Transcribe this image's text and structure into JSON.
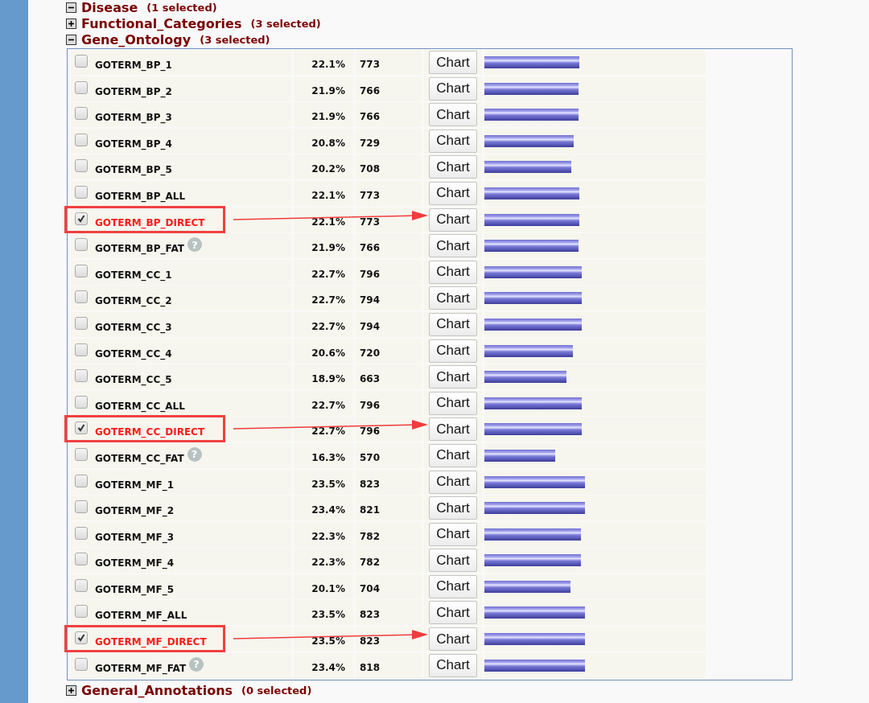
{
  "sections_top": [
    {
      "title": "Disease",
      "count": "(1 selected)",
      "expanded": true
    },
    {
      "title": "Functional_Categories",
      "count": "(3 selected)",
      "expanded": false
    },
    {
      "title": "Gene_Ontology",
      "count": "(3 selected)",
      "expanded": true
    }
  ],
  "rows": [
    {
      "name": "GOTERM_BP_1",
      "checked": false,
      "annotated": false,
      "percent": "22.1%",
      "count": "773",
      "button": "Chart",
      "level": 0.43
    },
    {
      "name": "GOTERM_BP_2",
      "checked": false,
      "annotated": false,
      "percent": "21.9%",
      "count": "766",
      "button": "Chart",
      "level": 0.425
    },
    {
      "name": "GOTERM_BP_3",
      "checked": false,
      "annotated": false,
      "percent": "21.9%",
      "count": "766",
      "button": "Chart",
      "level": 0.425
    },
    {
      "name": "GOTERM_BP_4",
      "checked": false,
      "annotated": false,
      "percent": "20.8%",
      "count": "729",
      "button": "Chart",
      "level": 0.405
    },
    {
      "name": "GOTERM_BP_5",
      "checked": false,
      "annotated": false,
      "percent": "20.2%",
      "count": "708",
      "button": "Chart",
      "level": 0.393
    },
    {
      "name": "GOTERM_BP_ALL",
      "checked": false,
      "annotated": false,
      "percent": "22.1%",
      "count": "773",
      "button": "Chart",
      "level": 0.43
    },
    {
      "name": "GOTERM_BP_DIRECT",
      "checked": true,
      "annotated": true,
      "percent": "22.1%",
      "count": "773",
      "button": "Chart",
      "level": 0.43
    },
    {
      "name": "GOTERM_BP_FAT",
      "checked": false,
      "annotated": false,
      "help": "?",
      "percent": "21.9%",
      "count": "766",
      "button": "Chart",
      "level": 0.425
    },
    {
      "name": "GOTERM_CC_1",
      "checked": false,
      "annotated": false,
      "percent": "22.7%",
      "count": "796",
      "button": "Chart",
      "level": 0.44
    },
    {
      "name": "GOTERM_CC_2",
      "checked": false,
      "annotated": false,
      "percent": "22.7%",
      "count": "794",
      "button": "Chart",
      "level": 0.44
    },
    {
      "name": "GOTERM_CC_3",
      "checked": false,
      "annotated": false,
      "percent": "22.7%",
      "count": "794",
      "button": "Chart",
      "level": 0.44
    },
    {
      "name": "GOTERM_CC_4",
      "checked": false,
      "annotated": false,
      "percent": "20.6%",
      "count": "720",
      "button": "Chart",
      "level": 0.4
    },
    {
      "name": "GOTERM_CC_5",
      "checked": false,
      "annotated": false,
      "percent": "18.9%",
      "count": "663",
      "button": "Chart",
      "level": 0.37
    },
    {
      "name": "GOTERM_CC_ALL",
      "checked": false,
      "annotated": false,
      "percent": "22.7%",
      "count": "796",
      "button": "Chart",
      "level": 0.44
    },
    {
      "name": "GOTERM_CC_DIRECT",
      "checked": true,
      "annotated": true,
      "percent": "22.7%",
      "count": "796",
      "button": "Chart",
      "level": 0.44
    },
    {
      "name": "GOTERM_CC_FAT",
      "checked": false,
      "annotated": false,
      "help": "?",
      "percent": "16.3%",
      "count": "570",
      "button": "Chart",
      "level": 0.32
    },
    {
      "name": "GOTERM_MF_1",
      "checked": false,
      "annotated": false,
      "percent": "23.5%",
      "count": "823",
      "button": "Chart",
      "level": 0.455
    },
    {
      "name": "GOTERM_MF_2",
      "checked": false,
      "annotated": false,
      "percent": "23.4%",
      "count": "821",
      "button": "Chart",
      "level": 0.455
    },
    {
      "name": "GOTERM_MF_3",
      "checked": false,
      "annotated": false,
      "percent": "22.3%",
      "count": "782",
      "button": "Chart",
      "level": 0.435
    },
    {
      "name": "GOTERM_MF_4",
      "checked": false,
      "annotated": false,
      "percent": "22.3%",
      "count": "782",
      "button": "Chart",
      "level": 0.435
    },
    {
      "name": "GOTERM_MF_5",
      "checked": false,
      "annotated": false,
      "percent": "20.1%",
      "count": "704",
      "button": "Chart",
      "level": 0.39
    },
    {
      "name": "GOTERM_MF_ALL",
      "checked": false,
      "annotated": false,
      "percent": "23.5%",
      "count": "823",
      "button": "Chart",
      "level": 0.455
    },
    {
      "name": "GOTERM_MF_DIRECT",
      "checked": true,
      "annotated": true,
      "percent": "23.5%",
      "count": "823",
      "button": "Chart",
      "level": 0.455
    },
    {
      "name": "GOTERM_MF_FAT",
      "checked": false,
      "annotated": false,
      "help": "?",
      "percent": "23.4%",
      "count": "818",
      "button": "Chart",
      "level": 0.453
    }
  ],
  "sections_bottom": [
    {
      "title": "General_Annotations",
      "count": "(0 selected)",
      "expanded": false
    }
  ]
}
